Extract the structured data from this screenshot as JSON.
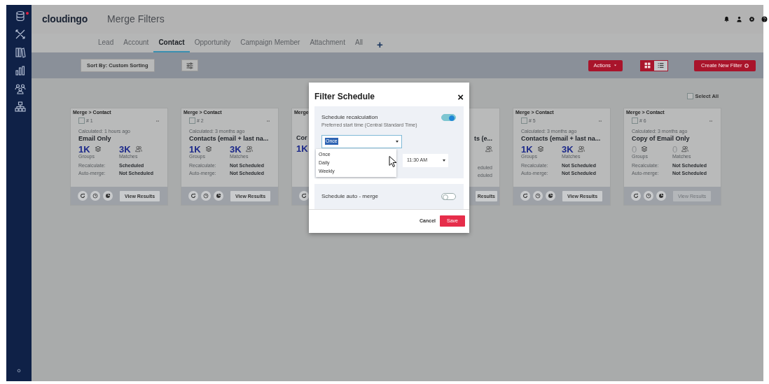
{
  "sidebar": {
    "items": [
      {
        "kind": "database",
        "alert": true
      },
      {
        "kind": "tools",
        "alert": false
      },
      {
        "kind": "library",
        "alert": false
      },
      {
        "kind": "chart",
        "alert": false
      },
      {
        "kind": "people",
        "alert": false
      },
      {
        "kind": "hierarchy",
        "alert": false
      }
    ]
  },
  "header": {
    "logo": "cloudingo",
    "title": "Merge Filters"
  },
  "tabs": [
    {
      "label": "Lead",
      "selected": false
    },
    {
      "label": "Account",
      "selected": false
    },
    {
      "label": "Contact",
      "selected": true
    },
    {
      "label": "Opportunity",
      "selected": false
    },
    {
      "label": "Campaign Member",
      "selected": false
    },
    {
      "label": "Attachment",
      "selected": false
    },
    {
      "label": "All",
      "selected": false
    },
    {
      "label": "+",
      "selected": false
    }
  ],
  "toolbar": {
    "sort": "Sort By: Custom Sorting",
    "actions": "Actions",
    "views": [
      {
        "kind": "grid",
        "selected": true
      },
      {
        "kind": "list",
        "selected": false
      }
    ],
    "create": "Create New Filter"
  },
  "select_all": {
    "label": "Select All",
    "checked": false
  },
  "cards": [
    {
      "kind": "full",
      "breadcrumb": "Merge > Contact",
      "number": "# 1",
      "checked": false,
      "calculated": "Calculated: 1 hours ago",
      "title": "Email Only",
      "groups": "1K",
      "groups_label": "Groups",
      "matches": "3K",
      "matches_label": "Matches",
      "recalc_label": "Recalculate:",
      "recalc": "Scheduled",
      "auto_label": "Auto-merge:",
      "auto": "Not Scheduled",
      "view": "View Results",
      "disabled": false
    },
    {
      "kind": "full",
      "breadcrumb": "Merge > Contact",
      "number": "# 2",
      "checked": false,
      "calculated": "Calculated: 3 months ago",
      "title": "Contacts (email + last na...",
      "groups": "1K",
      "groups_label": "Groups",
      "matches": "3K",
      "matches_label": "Matches",
      "recalc_label": "Recalculate:",
      "recalc": "Not Scheduled",
      "auto_label": "Auto-merge:",
      "auto": "Not Scheduled",
      "view": "View Results",
      "disabled": false
    },
    {
      "kind": "left",
      "breadcrumb": "Merge",
      "title": "Cor",
      "groups": "1K"
    },
    {
      "kind": "right",
      "title": "ts (e...",
      "recalc": "eduled",
      "auto": "eduled",
      "view": "Results"
    },
    {
      "kind": "full",
      "breadcrumb": "Merge > Contact",
      "number": "# 5",
      "checked": false,
      "calculated": "Calculated: 3 months ago",
      "title": "Contacts (email + last na...",
      "groups": "1K",
      "groups_label": "Groups",
      "matches": "3K",
      "matches_label": "Matches",
      "recalc_label": "Recalculate:",
      "recalc": "Not Scheduled",
      "auto_label": "Auto-merge:",
      "auto": "Not Scheduled",
      "view": "View Results",
      "disabled": false
    },
    {
      "kind": "full",
      "breadcrumb": "Merge > Contact",
      "number": "# 6",
      "checked": false,
      "calculated": "Calculated: 3 months ago",
      "title": "Copy of Email Only",
      "groups": "0",
      "groups_label": "Groups",
      "matches": "0",
      "matches_label": "Matches",
      "recalc_label": "Recalculate:",
      "recalc": "Not Scheduled",
      "auto_label": "Auto-merge:",
      "auto": "Not Scheduled",
      "view": "View Results",
      "disabled": true
    }
  ],
  "modal": {
    "title": "Filter Schedule",
    "close": "×",
    "recalc_label": "Schedule recalculation",
    "recalc_on": true,
    "hint": "Preferred start time (Central Standard Time)",
    "frequency": "Once",
    "options": [
      {
        "label": "Once",
        "selected": false
      },
      {
        "label": "Daily",
        "selected": false
      },
      {
        "label": "Weekly",
        "selected": false
      }
    ],
    "time": "11:30 AM",
    "auto_label": "Schedule auto - merge",
    "auto_on": false,
    "cancel": "Cancel",
    "save": "Save"
  }
}
